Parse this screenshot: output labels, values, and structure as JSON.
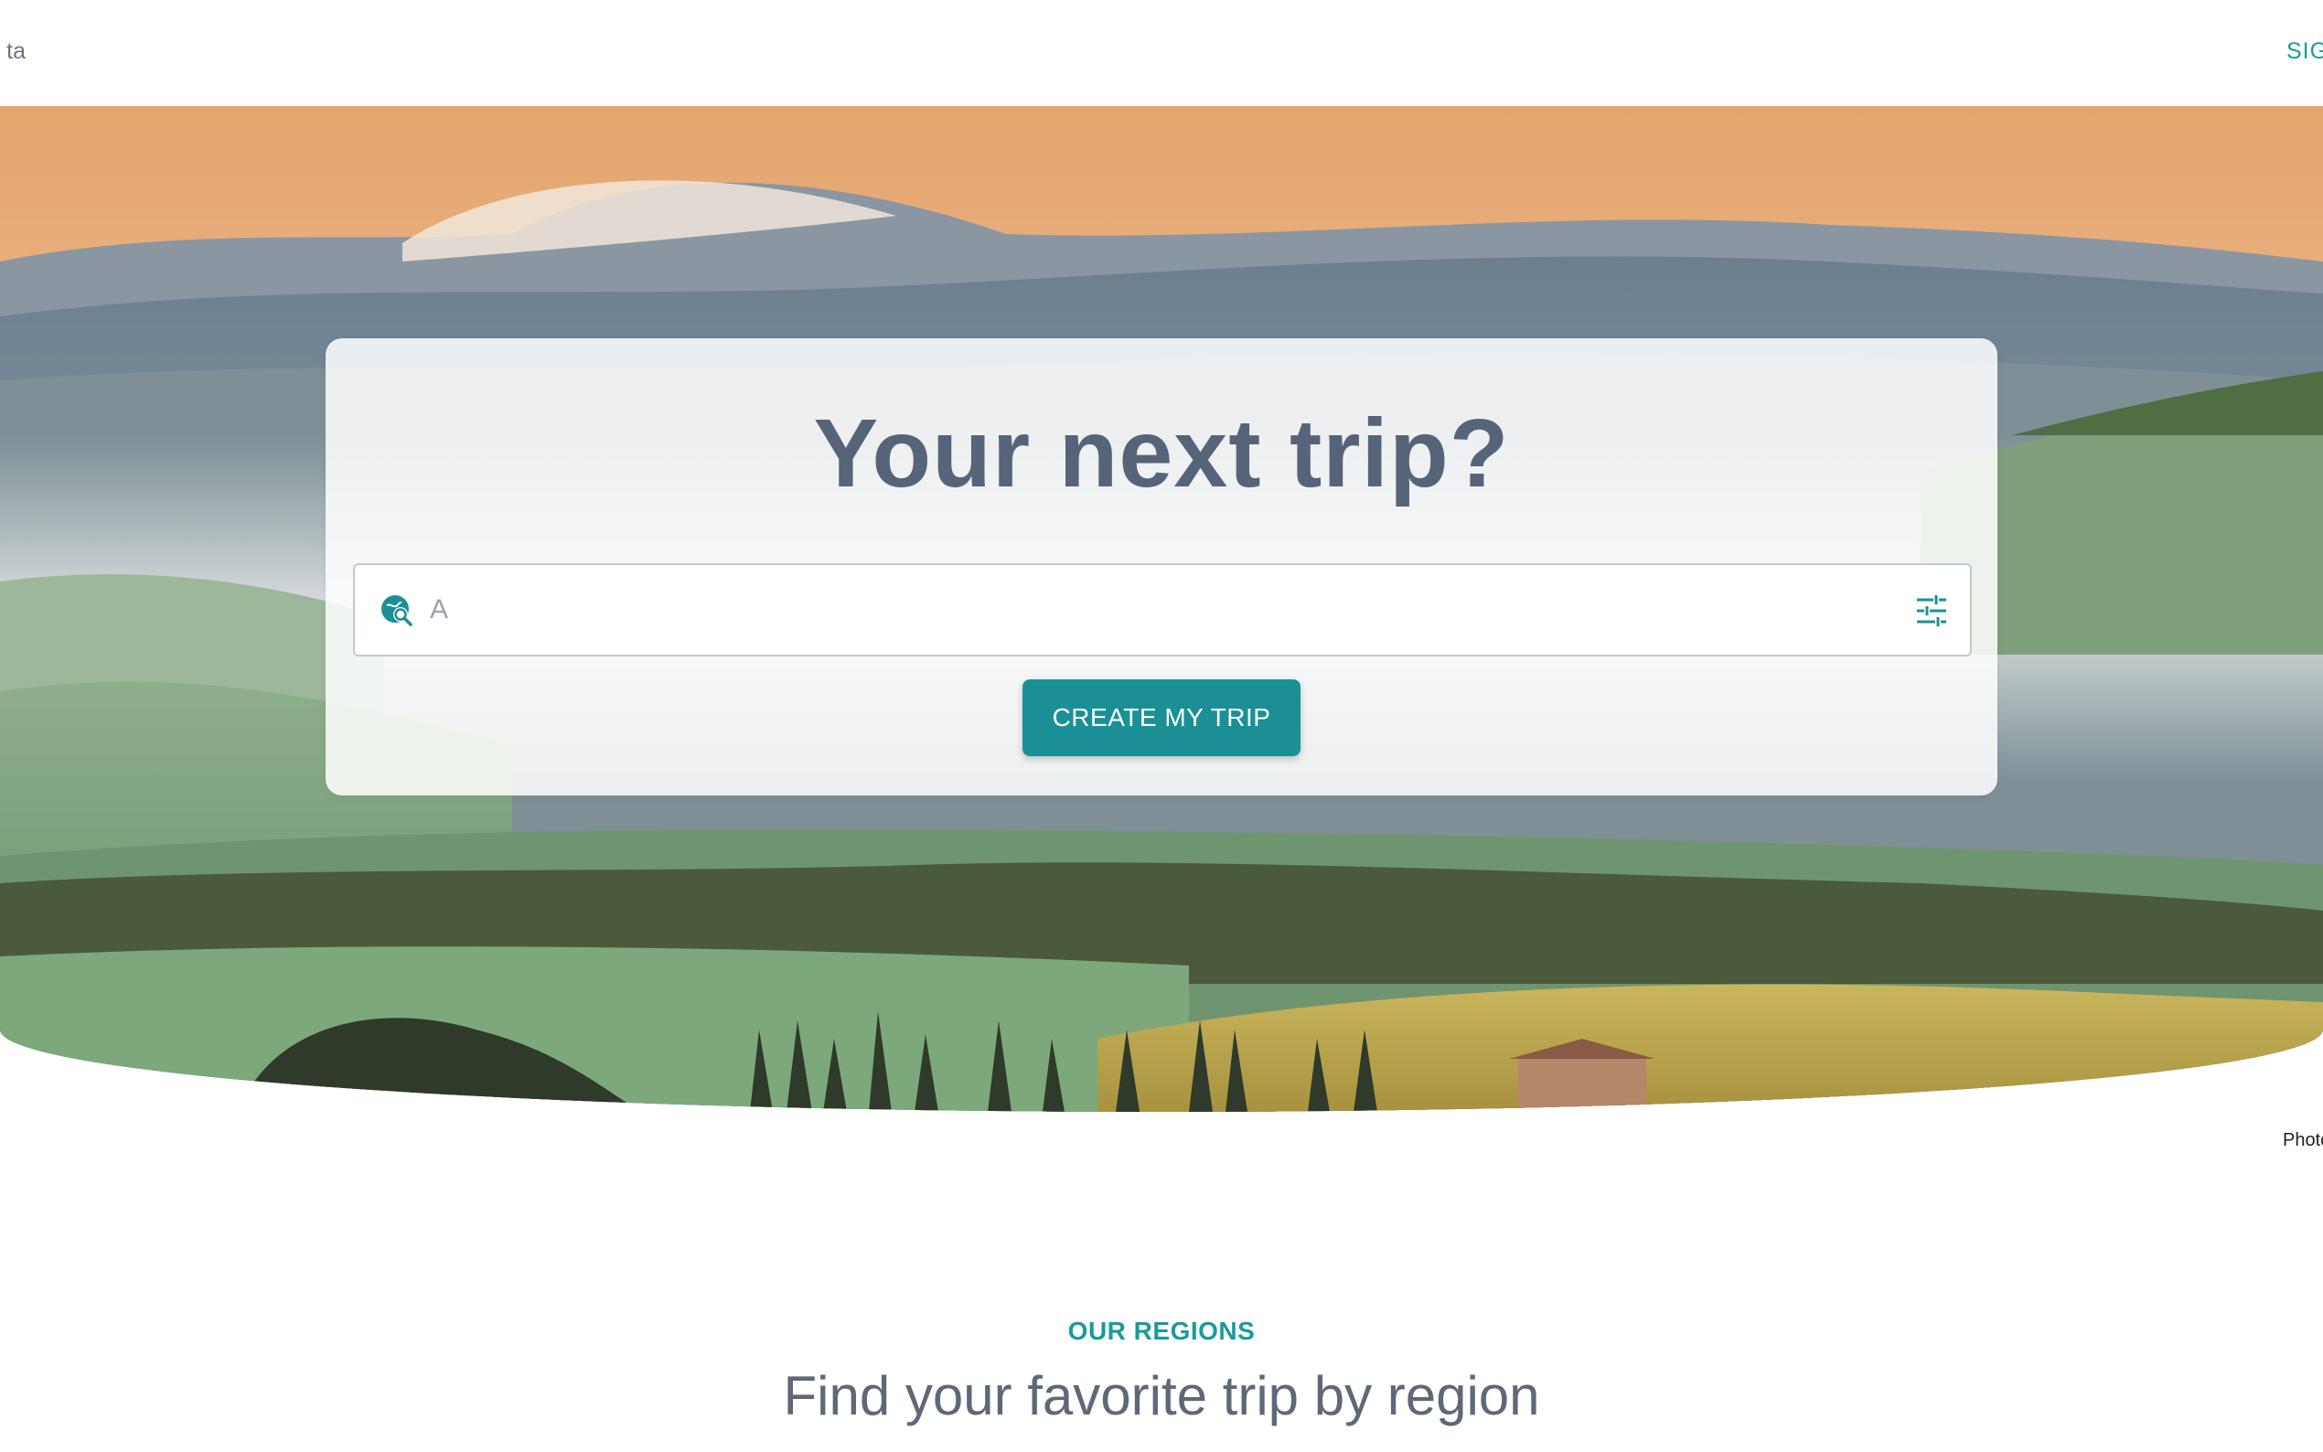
{
  "header": {
    "brand_text": "ta",
    "signin_label": "SIGN IN"
  },
  "hero": {
    "title": "Your next trip?",
    "search": {
      "value": "A",
      "placeholder": "A",
      "leading_icon": "globe-search-icon",
      "trailing_icon": "tune-filters-icon"
    },
    "cta_label": "CREATE MY TRIP",
    "photo_credit": "Photo"
  },
  "regions": {
    "eyebrow": "OUR REGIONS",
    "title": "Find your favorite trip by region"
  },
  "colors": {
    "accent": "#1a9096",
    "accent_text": "#1a9a9d",
    "title_text": "#566479"
  }
}
